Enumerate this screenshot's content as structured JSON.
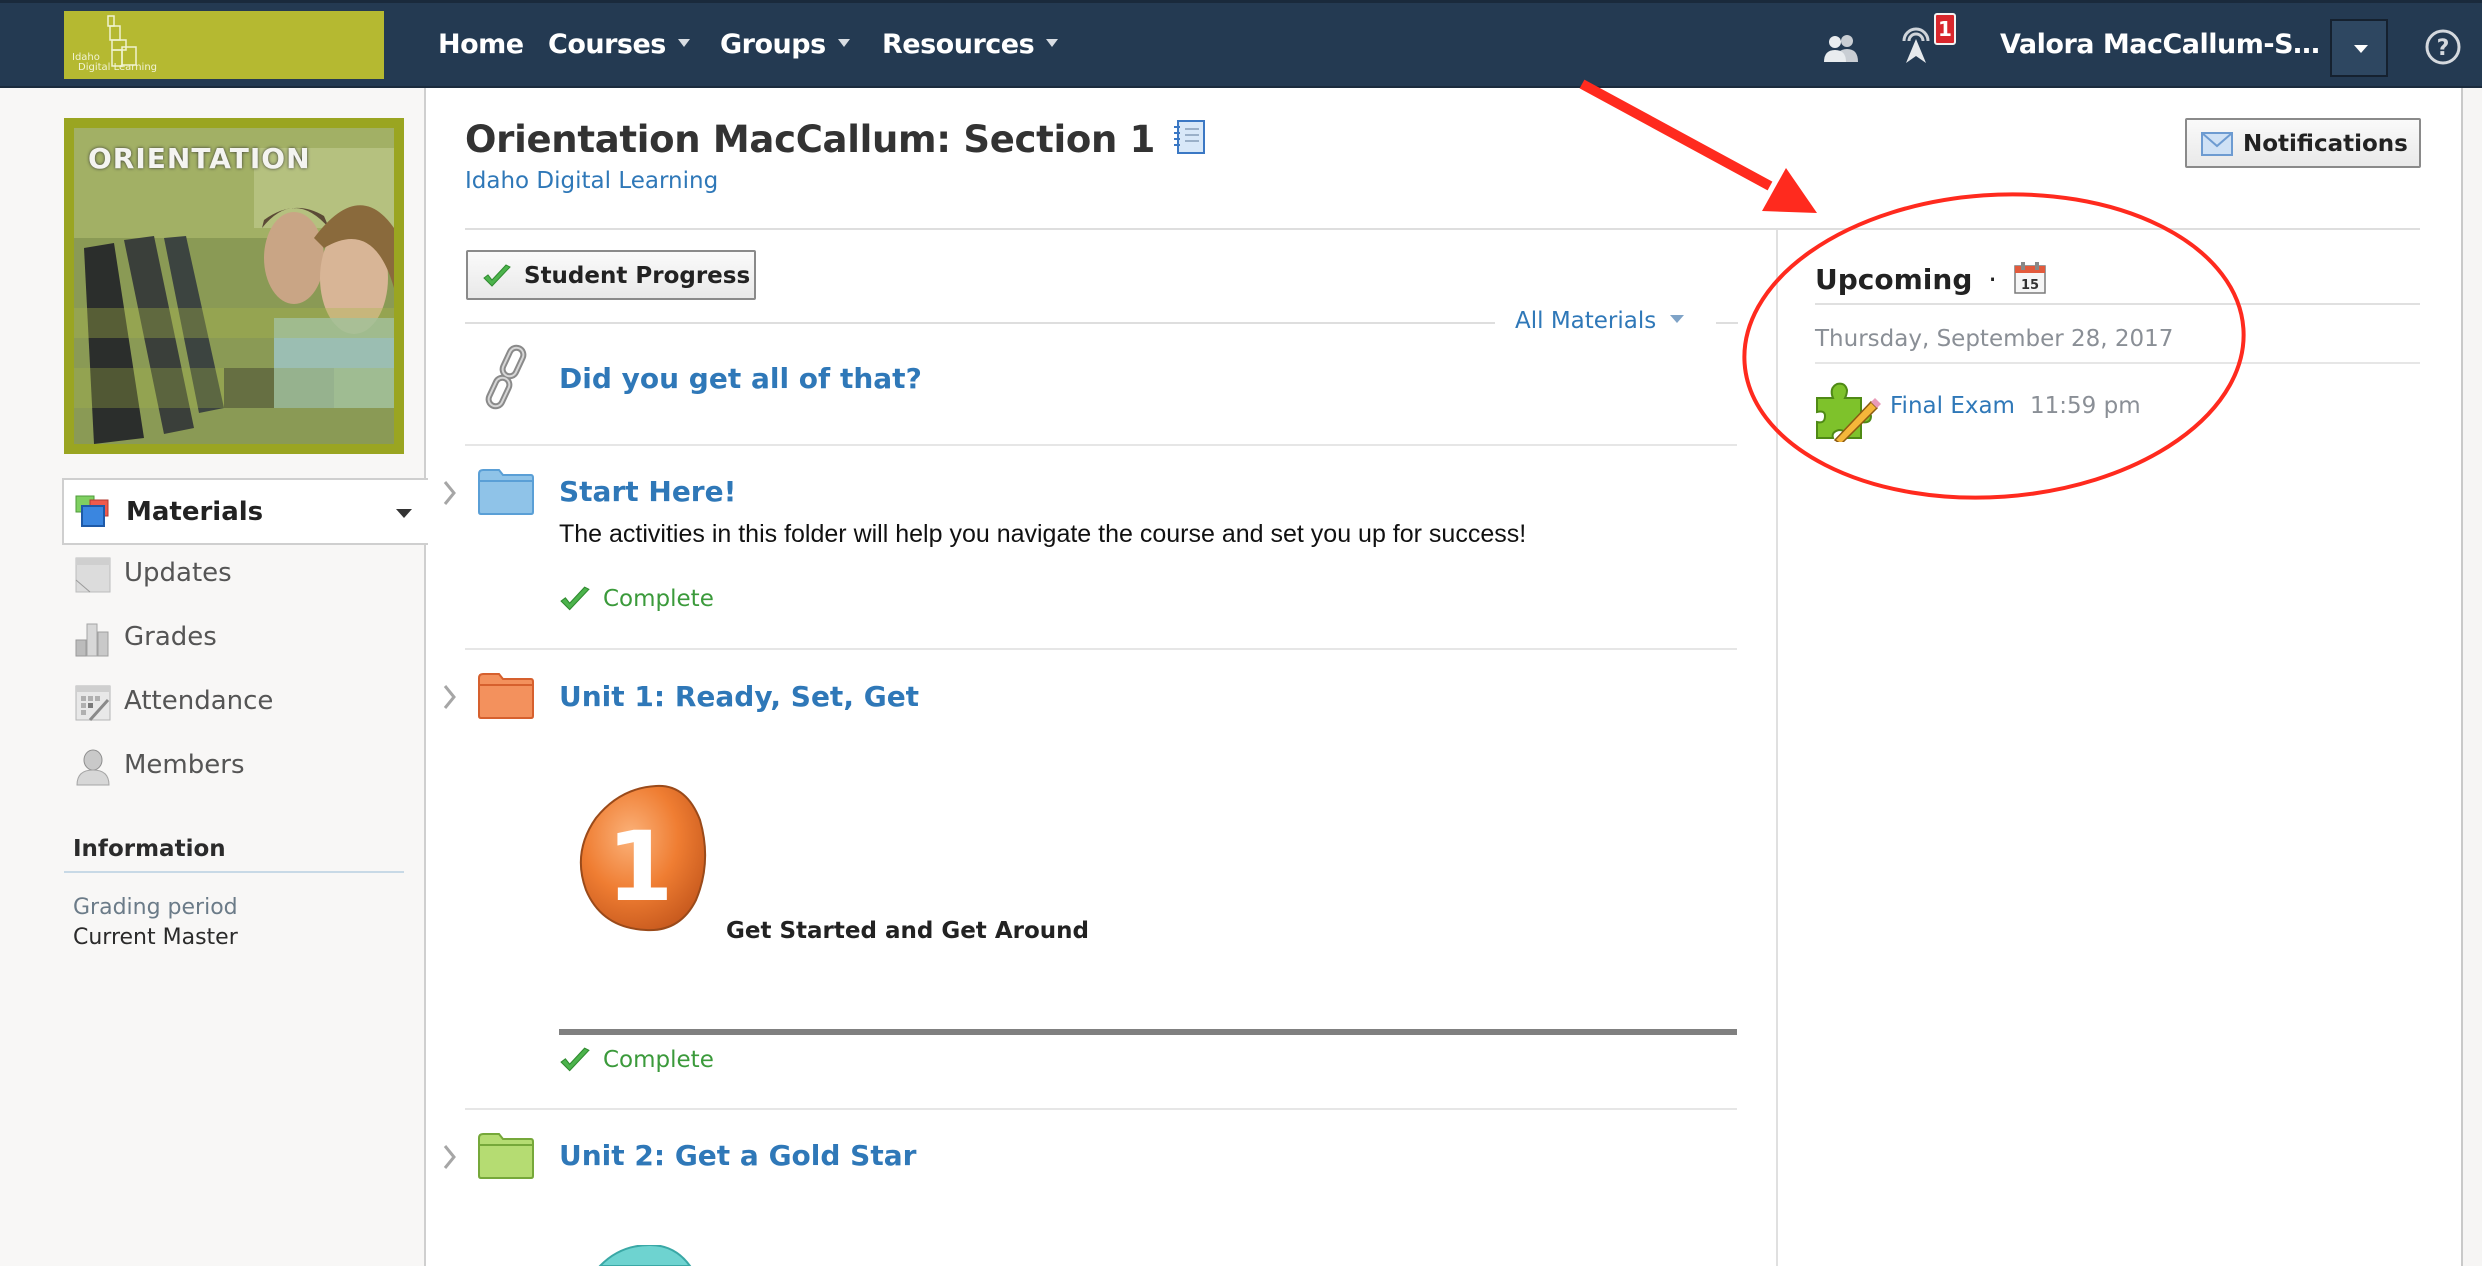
{
  "header": {
    "logo_text_line1": "Idaho",
    "logo_text_line2": "Digital Learning",
    "nav": [
      {
        "label": "Home",
        "has_dropdown": false
      },
      {
        "label": "Courses",
        "has_dropdown": true
      },
      {
        "label": "Groups",
        "has_dropdown": true
      },
      {
        "label": "Resources",
        "has_dropdown": true
      }
    ],
    "icons": [
      "people-icon",
      "broadcast-icon",
      "help-icon"
    ],
    "notification_count": "1",
    "user_name": "Valora MacCallum-S…"
  },
  "sidebar": {
    "course_image_title": "ORIENTATION",
    "active_tab": "Materials",
    "items": [
      {
        "label": "Updates",
        "icon": "updates-icon"
      },
      {
        "label": "Grades",
        "icon": "grades-icon"
      },
      {
        "label": "Attendance",
        "icon": "attendance-icon"
      },
      {
        "label": "Members",
        "icon": "members-icon"
      }
    ],
    "information": {
      "heading": "Information",
      "key": "Grading period",
      "value": "Current Master"
    }
  },
  "main": {
    "title": "Orientation MacCallum: Section 1",
    "subtitle": "Idaho Digital Learning",
    "student_progress_label": "Student Progress",
    "filter_label": "All Materials",
    "materials": [
      {
        "type": "link",
        "title": "Did you get all of that?"
      },
      {
        "type": "folder",
        "color": "#8fc3e8",
        "title": "Start Here!",
        "description": "The activities in this folder will help you navigate the course and set you up for success!",
        "status": "Complete"
      },
      {
        "type": "folder",
        "color": "#f3915d",
        "title": "Unit 1: Ready, Set, Get",
        "banner_number": "1",
        "banner_caption": "Get Started and Get Around",
        "status": "Complete"
      },
      {
        "type": "folder",
        "color": "#b5dc72",
        "title": "Unit 2: Get a Gold Star"
      }
    ]
  },
  "right_panel": {
    "notifications_label": "Notifications",
    "upcoming_heading": "Upcoming",
    "upcoming_separator": "·",
    "calendar_day": "15",
    "date": "Thursday, September 28, 2017",
    "events": [
      {
        "title": "Final Exam",
        "time": "11:59 pm"
      }
    ]
  },
  "annotation": {
    "color": "#ff2a1e",
    "shapes": [
      "arrow",
      "ellipse"
    ]
  }
}
